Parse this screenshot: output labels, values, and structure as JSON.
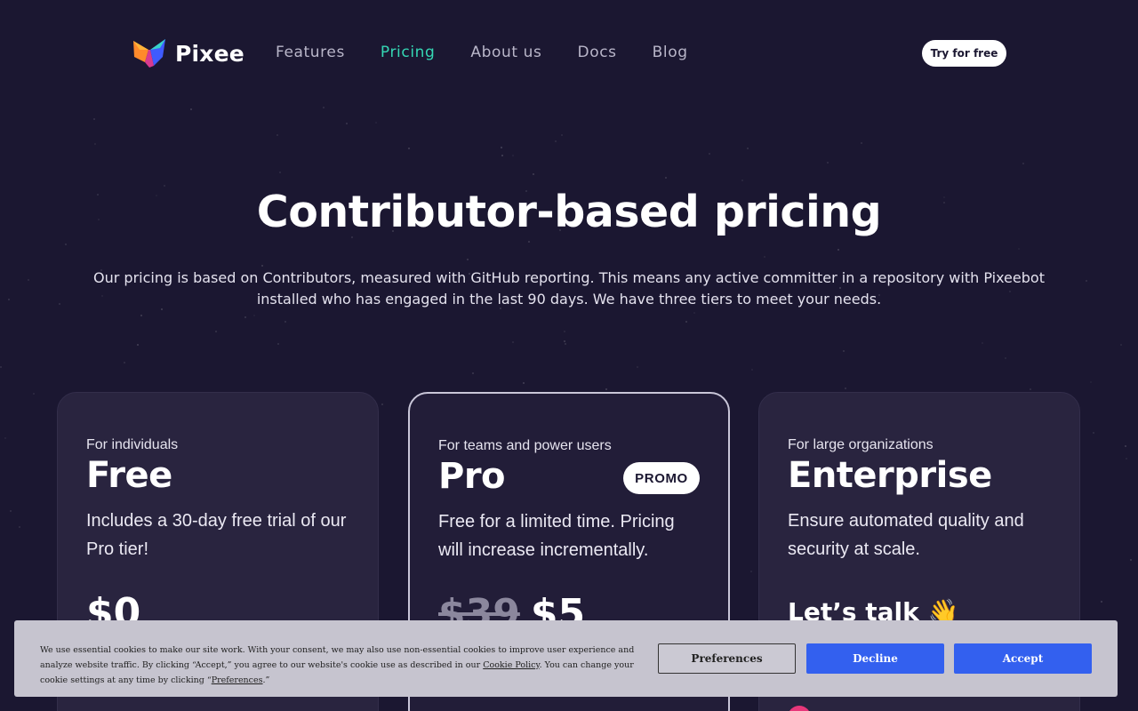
{
  "brand": {
    "name": "Pixee"
  },
  "nav": {
    "items": [
      {
        "label": "Features",
        "active": false
      },
      {
        "label": "Pricing",
        "active": true
      },
      {
        "label": "About us",
        "active": false
      },
      {
        "label": "Docs",
        "active": false
      },
      {
        "label": "Blog",
        "active": false
      }
    ],
    "cta": "Try for free"
  },
  "hero": {
    "title": "Contributor-based pricing",
    "subtitle": "Our pricing is based on Contributors, measured with GitHub reporting. This means any active committer in a repository with Pixeebot installed who has engaged in the last 90 days. We have three tiers to meet your needs."
  },
  "plans": {
    "free": {
      "tag": "For individuals",
      "name": "Free",
      "description": "Includes a 30-day free trial of our Pro tier!",
      "price": "$0"
    },
    "pro": {
      "tag": "For teams and power users",
      "name": "Pro",
      "badge": "PROMO",
      "description": "Free for a limited time. Pricing will increase incrementally.",
      "old_price": "$39",
      "price": "$5"
    },
    "enterprise": {
      "tag": "For large organizations",
      "name": "Enterprise",
      "description": "Ensure automated quality and security at scale.",
      "cta_text": "Let’s talk 👋"
    }
  },
  "cookie": {
    "text_1": "We use essential cookies to make our site work. With your consent, we may also use non-essential cookies to improve user experience and analyze website traffic. By clicking “Accept,” you agree to our website's cookie use as described in our ",
    "policy_link": "Cookie Policy",
    "text_2": ". You can change your cookie settings at any time by clicking “",
    "prefs_link": "Preferences",
    "text_3": ".”",
    "buttons": {
      "preferences": "Preferences",
      "decline": "Decline",
      "accept": "Accept"
    }
  },
  "colors": {
    "background": "#1b1731",
    "accent": "#35d7b4",
    "button_blue": "#3360ef",
    "promo_pink": "#e8377a"
  }
}
